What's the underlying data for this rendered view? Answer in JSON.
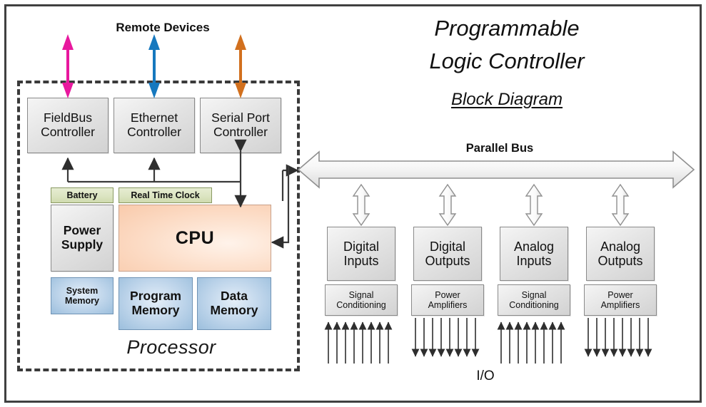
{
  "document": {
    "title_line1": "Programmable",
    "title_line2": "Logic Controller",
    "subtitle": "Block Diagram"
  },
  "labels": {
    "remote_devices": "Remote Devices",
    "parallel_bus": "Parallel Bus",
    "io": "I/O",
    "processor": "Processor"
  },
  "processor": {
    "communication_controllers": [
      {
        "name": "FieldBus Controller",
        "line1": "FieldBus",
        "line2": "Controller",
        "arrow_color": "#E8189E"
      },
      {
        "name": "Ethernet Controller",
        "line1": "Ethernet",
        "line2": "Controller",
        "arrow_color": "#1678BE"
      },
      {
        "name": "Serial Port Controller",
        "line1": "Serial Port",
        "line2": "Controller",
        "arrow_color": "#D2701E"
      }
    ],
    "battery": "Battery",
    "real_time_clock": "Real Time Clock",
    "power_supply_line1": "Power",
    "power_supply_line2": "Supply",
    "cpu": "CPU",
    "system_memory_line1": "System",
    "system_memory_line2": "Memory",
    "program_memory_line1": "Program",
    "program_memory_line2": "Memory",
    "data_memory_line1": "Data",
    "data_memory_line2": "Memory"
  },
  "io_section": {
    "modules": [
      {
        "line1": "Digital",
        "line2": "Inputs",
        "sub_line1": "Signal",
        "sub_line2": "Conditioning",
        "direction": "input",
        "field_line_count": 8
      },
      {
        "line1": "Digital",
        "line2": "Outputs",
        "sub_line1": "Power",
        "sub_line2": "Amplifiers",
        "direction": "output",
        "field_line_count": 8
      },
      {
        "line1": "Analog",
        "line2": "Inputs",
        "sub_line1": "Signal",
        "sub_line2": "Conditioning",
        "direction": "input",
        "field_line_count": 8
      },
      {
        "line1": "Analog",
        "line2": "Outputs",
        "sub_line1": "Power",
        "sub_line2": "Amplifiers",
        "direction": "output",
        "field_line_count": 8
      }
    ]
  },
  "colors": {
    "frame_border": "#404040",
    "dashed_border": "#3a3a3a",
    "grey_block": "#e4e4e4",
    "green_block": "#dbe4c0",
    "cpu_block": "#fcdcc6",
    "memory_block": "#bdd4ea",
    "bus_fill": "#f4f4f4",
    "line": "#3a3a3a"
  }
}
